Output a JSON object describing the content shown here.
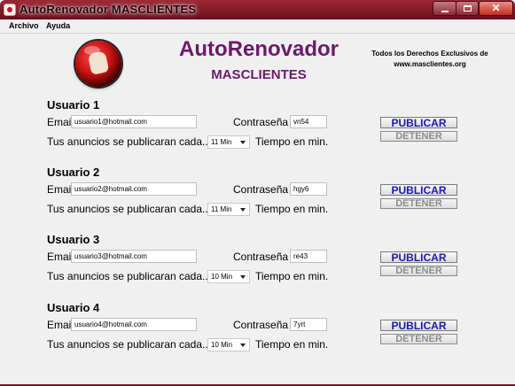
{
  "window": {
    "title": "AutoRenovador MASCLIENTES",
    "close_glyph": "✕"
  },
  "menu": {
    "items": [
      "Archivo",
      "Ayuda"
    ]
  },
  "header": {
    "title": "AutoRenovador",
    "subtitle": "MASCLIENTES",
    "rights_line1": "Todos los Derechos Exclusivos de",
    "rights_line2": "www.masclientes.org"
  },
  "labels": {
    "email": "Email",
    "password": "Contraseña",
    "every": "Tus anuncios se publicaran cada...",
    "time": "Tiempo en min.",
    "publish": "PUBLICAR",
    "stop": "DETENER"
  },
  "users": [
    {
      "title": "Usuario 1",
      "email": "usuario1@hotmail.com",
      "password": "vn54",
      "interval": "11 Min"
    },
    {
      "title": "Usuario 2",
      "email": "usuario2@hotmail.com",
      "password": "hgy6",
      "interval": "11 Min"
    },
    {
      "title": "Usuario 3",
      "email": "usuario3@hotmail.com",
      "password": "re43",
      "interval": "10 Min"
    },
    {
      "title": "Usuario 4",
      "email": "usuario4@hotmail.com",
      "password": "7yrt",
      "interval": "10 Min"
    }
  ],
  "colors": {
    "title_bar": "#7a1422",
    "title_purple": "#6b1a6b",
    "publish_text": "#1a1aa6",
    "stop_text": "#8c8c8c"
  }
}
